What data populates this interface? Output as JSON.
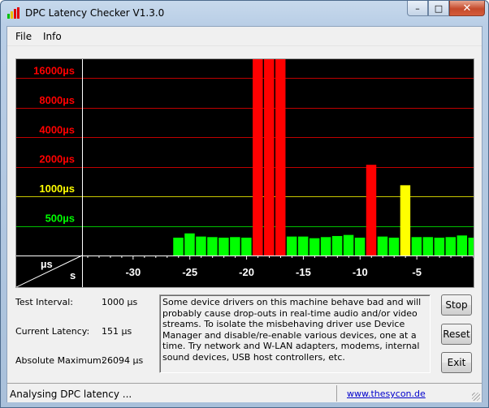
{
  "window": {
    "title": "DPC Latency Checker V1.3.0",
    "minimize_glyph": "–",
    "maximize_glyph": "□",
    "close_glyph": "✕"
  },
  "menu": {
    "items": [
      "File",
      "Info"
    ]
  },
  "chart_data": {
    "type": "bar",
    "ylabels": [
      {
        "text": "16000µs",
        "color": "#ff0000"
      },
      {
        "text": "8000µs",
        "color": "#ff0000"
      },
      {
        "text": "4000µs",
        "color": "#ff0000"
      },
      {
        "text": "2000µs",
        "color": "#ff0000"
      },
      {
        "text": "1000µs",
        "color": "#ffff00"
      },
      {
        "text": "500µs",
        "color": "#00ff00"
      }
    ],
    "gridlines": [
      {
        "value": 16000,
        "color": "#c00000"
      },
      {
        "value": 8000,
        "color": "#c00000"
      },
      {
        "value": 4000,
        "color": "#c00000"
      },
      {
        "value": 2000,
        "color": "#c00000"
      },
      {
        "value": 1000,
        "color": "#c8c800"
      },
      {
        "value": 500,
        "color": "#00c000"
      }
    ],
    "corner_unit_y": "µs",
    "corner_unit_x": "s",
    "xticks": [
      "-30",
      "-25",
      "-20",
      "-15",
      "-10",
      "-5"
    ],
    "xtick_values": [
      -30,
      -25,
      -20,
      -15,
      -10,
      -5
    ],
    "xlim": [
      -34.5,
      0
    ],
    "y_scale": "log2",
    "ylim": [
      250,
      25000
    ],
    "colors": {
      "ok": "#00ff00",
      "warn": "#ffff00",
      "bad": "#ff0000"
    },
    "bars": [
      {
        "t": -26,
        "value": 380
      },
      {
        "t": -25,
        "value": 420
      },
      {
        "t": -24,
        "value": 390
      },
      {
        "t": -23,
        "value": 385
      },
      {
        "t": -22,
        "value": 380
      },
      {
        "t": -21,
        "value": 385
      },
      {
        "t": -20,
        "value": 380
      },
      {
        "t": -19,
        "value": 26094
      },
      {
        "t": -18,
        "value": 26094
      },
      {
        "t": -17,
        "value": 26094
      },
      {
        "t": -16,
        "value": 390
      },
      {
        "t": -15,
        "value": 390
      },
      {
        "t": -14,
        "value": 375
      },
      {
        "t": -13,
        "value": 385
      },
      {
        "t": -12,
        "value": 395
      },
      {
        "t": -11,
        "value": 405
      },
      {
        "t": -10,
        "value": 380
      },
      {
        "t": -9,
        "value": 2100
      },
      {
        "t": -8,
        "value": 390
      },
      {
        "t": -7,
        "value": 380
      },
      {
        "t": -6,
        "value": 1300
      },
      {
        "t": -5,
        "value": 385
      },
      {
        "t": -4,
        "value": 385
      },
      {
        "t": -3,
        "value": 380
      },
      {
        "t": -2,
        "value": 385
      },
      {
        "t": -1,
        "value": 400
      },
      {
        "t": 0,
        "value": 380
      }
    ]
  },
  "stats": {
    "test_interval_label": "Test Interval:",
    "test_interval_value": "1000 µs",
    "current_latency_label": "Current Latency:",
    "current_latency_value": "151 µs",
    "absolute_maximum_label": "Absolute Maximum:",
    "absolute_maximum_value": "26094 µs"
  },
  "message": "Some device drivers on this machine behave bad and will probably cause drop-outs in real-time audio and/or video streams. To isolate the misbehaving driver use Device Manager and disable/re-enable various devices, one at a time. Try network and W-LAN adapters, modems, internal sound devices, USB host controllers, etc.",
  "buttons": {
    "stop": "Stop",
    "reset": "Reset",
    "exit": "Exit"
  },
  "status": {
    "text": "Analysing DPC latency ...",
    "link": "www.thesycon.de"
  }
}
